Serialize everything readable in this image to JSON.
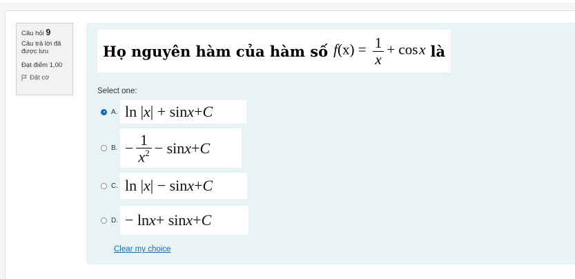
{
  "question_info": {
    "question_label": "Câu hỏi",
    "question_number": "9",
    "state": "Câu trả lời đã được lưu",
    "grade": "Đạt điểm 1,00",
    "flag_label": "Đặt cờ",
    "flag_icon": "flag-icon"
  },
  "question": {
    "text_prefix": "Họ nguyên hàm của hàm số",
    "func_name": "f",
    "func_arg": "(x) =",
    "frac_num": "1",
    "frac_den": "x",
    "tail": "+ cos",
    "tail_var": "x",
    "suffix": "là"
  },
  "prompt": "Select one:",
  "options": [
    {
      "letter": "A.",
      "selected": true,
      "parts": {
        "p1": "ln |",
        "v1": "x",
        "p2": "| + sin ",
        "v2": "x",
        "p3": " + ",
        "v3": "C"
      }
    },
    {
      "letter": "B.",
      "selected": false,
      "parts": {
        "p1": "−",
        "num": "1",
        "den_var": "x",
        "den_exp": "2",
        "p2": " − sin ",
        "v2": "x",
        "p3": " + ",
        "v3": "C"
      }
    },
    {
      "letter": "C.",
      "selected": false,
      "parts": {
        "p1": "ln |",
        "v1": "x",
        "p2": "| − sin ",
        "v2": "x",
        "p3": " + ",
        "v3": "C"
      }
    },
    {
      "letter": "D.",
      "selected": false,
      "parts": {
        "p1": "− ln ",
        "v1": "x",
        "p2": " + sin ",
        "v2": "x",
        "p3": " + ",
        "v3": "C"
      }
    }
  ],
  "clear_choice": "Clear my choice",
  "colors": {
    "accent": "#0f6cbf",
    "content_bg": "#e7f3f5",
    "info_bg": "#f2f2f2"
  }
}
